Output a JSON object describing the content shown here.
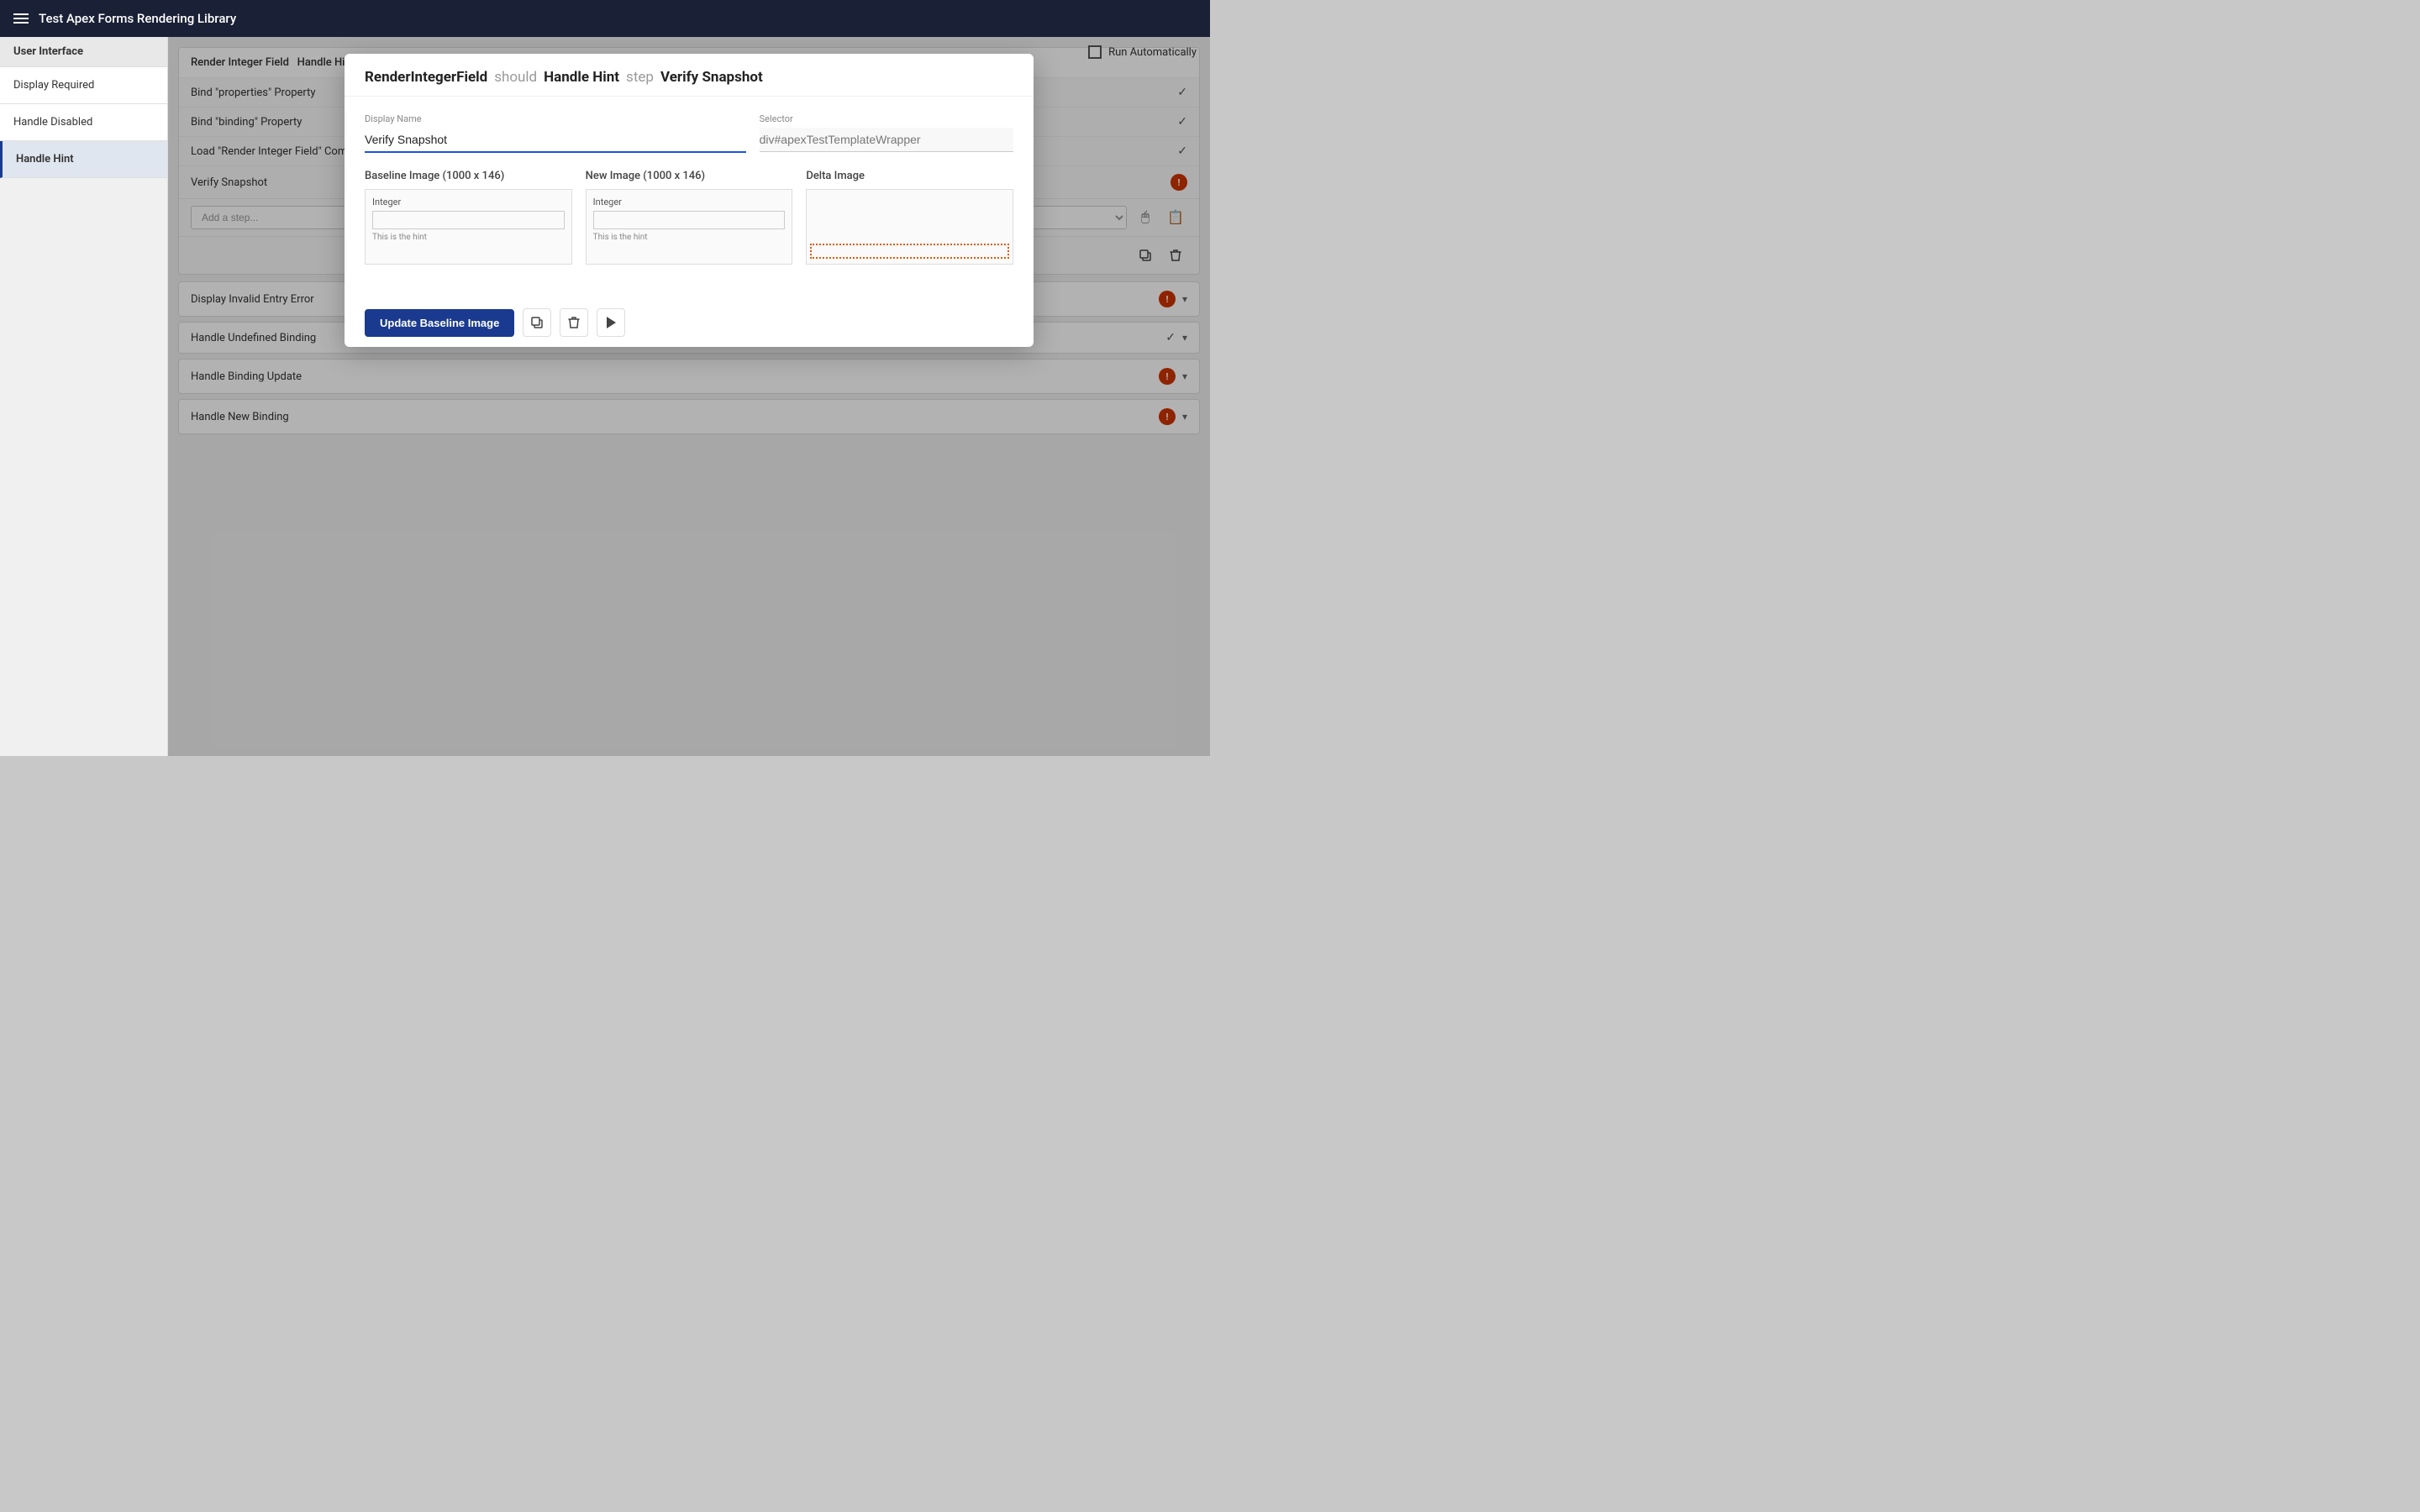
{
  "topbar": {
    "title": "Test Apex Forms Rendering Library",
    "menu_icon": "hamburger-icon"
  },
  "content_topbar": {
    "run_auto_label": "Run Automatically",
    "checkbox_checked": false
  },
  "left_sidebar": {
    "header": "User Interface",
    "items": [
      {
        "id": "display-required",
        "label": "Display Required",
        "active": false
      },
      {
        "id": "handle-disabled",
        "label": "Handle Disabled",
        "active": false
      },
      {
        "id": "handle-hint",
        "label": "Handle Hint",
        "active": true
      }
    ]
  },
  "test_group": {
    "title": "Render Integer Field",
    "subtitle": "Handle Hint",
    "steps": [
      {
        "id": "bind-properties",
        "label": "Bind \"properties\" Property",
        "status": "check"
      },
      {
        "id": "bind-binding",
        "label": "Bind \"binding\" Property",
        "status": "check"
      },
      {
        "id": "load-component",
        "label": "Load \"Render Integer Field\" Component",
        "status": "check"
      },
      {
        "id": "verify-snapshot",
        "label": "Verify Snapshot",
        "status": "error"
      }
    ],
    "add_step_placeholder": "Add a step...",
    "copy_icon": "copy-icon",
    "delete_icon": "delete-icon"
  },
  "bottom_items": [
    {
      "id": "display-invalid",
      "label": "Display Invalid Entry Error",
      "status": "error"
    },
    {
      "id": "handle-undefined",
      "label": "Handle Undefined Binding",
      "status": "check"
    },
    {
      "id": "handle-binding-update",
      "label": "Handle Binding Update",
      "status": "error"
    },
    {
      "id": "handle-new-binding",
      "label": "Handle New Binding",
      "status": "error"
    }
  ],
  "modal": {
    "visible": true,
    "breadcrumb_main": "RenderIntegerField",
    "breadcrumb_should": "should",
    "breadcrumb_test": "Handle Hint",
    "breadcrumb_step": "step",
    "breadcrumb_action": "Verify Snapshot",
    "display_name_label": "Display Name",
    "display_name_value": "Verify Snapshot",
    "selector_label": "Selector",
    "selector_value": "div#apexTestTemplateWrapper",
    "baseline_label": "Baseline Image (1000 x 146)",
    "new_image_label": "New Image (1000 x 146)",
    "delta_label": "Delta Image",
    "baseline_integer": "Integer",
    "baseline_hint": "This is the hint",
    "new_integer": "Integer",
    "new_hint": "This is the hint",
    "update_baseline_label": "Update Baseline Image",
    "copy_btn_label": "copy",
    "delete_btn_label": "delete",
    "play_btn_label": "play"
  }
}
